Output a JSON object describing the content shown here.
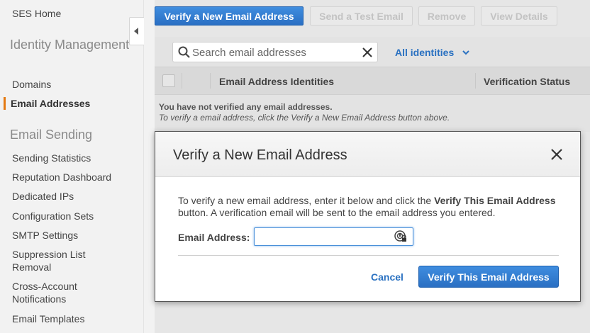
{
  "sidebar": {
    "home": "SES Home",
    "sections": [
      {
        "title": "Identity Management",
        "items": [
          "Domains",
          "Email Addresses"
        ]
      },
      {
        "title": "Email Sending",
        "items": [
          "Sending Statistics",
          "Reputation Dashboard",
          "Dedicated IPs",
          "Configuration Sets",
          "SMTP Settings",
          "Suppression List Removal",
          "Cross-Account Notifications",
          "Email Templates"
        ]
      }
    ],
    "active_item": "Email Addresses"
  },
  "toolbar": {
    "verify_new": "Verify a New Email Address",
    "send_test": "Send a Test Email",
    "remove": "Remove",
    "view_details": "View Details"
  },
  "search": {
    "placeholder": "Search email addresses",
    "value": ""
  },
  "filter": {
    "label": "All identities"
  },
  "table": {
    "columns": [
      "Email Address Identities",
      "Verification Status"
    ],
    "empty_title": "You have not verified any email addresses.",
    "empty_hint": "To verify a email address, click the Verify a New Email Address button above."
  },
  "modal": {
    "title": "Verify a New Email Address",
    "text_pre": "To verify a new email address, enter it below and click the ",
    "text_bold": "Verify This Email Address",
    "text_post": " button. A verification email will be sent to the email address you entered.",
    "email_label": "Email Address:",
    "email_value": "",
    "cancel": "Cancel",
    "confirm": "Verify This Email Address"
  },
  "colors": {
    "accent": "#2a71c1",
    "active_marker": "#e47911"
  }
}
